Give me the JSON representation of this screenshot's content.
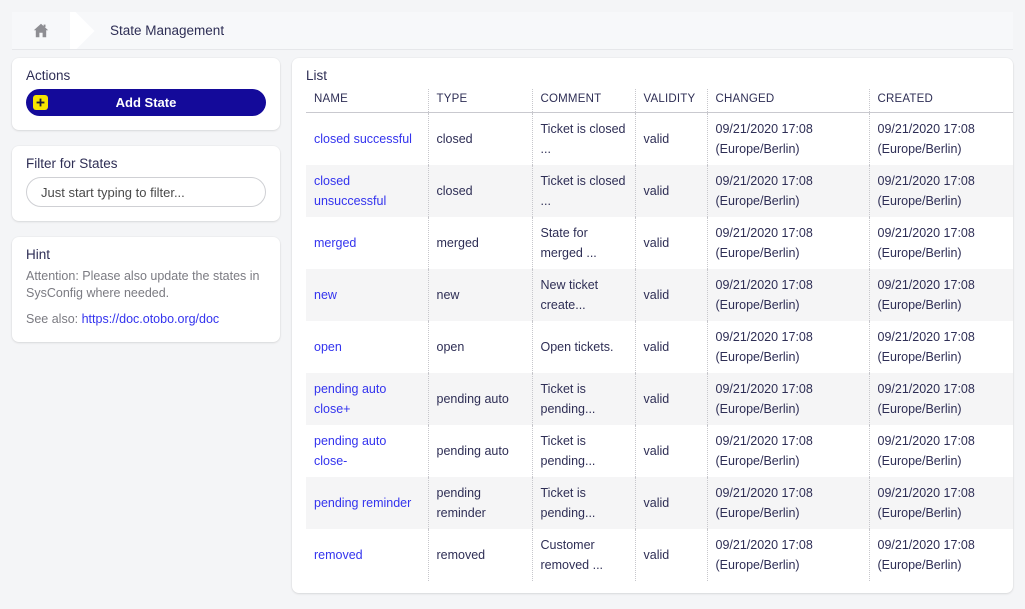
{
  "breadcrumb": {
    "home_icon": "home-icon",
    "separator_icon": "chevron-right-separator-icon",
    "title": "State Management"
  },
  "sidebar": {
    "actions": {
      "header": "Actions",
      "add_state_label": "Add State",
      "add_state_icon": "plus-icon"
    },
    "filter": {
      "header": "Filter for States",
      "placeholder": "Just start typing to filter...",
      "value": ""
    },
    "hint": {
      "header": "Hint",
      "text": "Attention: Please also update the states in SysConfig where needed.",
      "see_also_prefix": "See also: ",
      "link_text": "https://doc.otobo.org/doc"
    }
  },
  "main": {
    "list": {
      "header": "List",
      "columns": [
        "NAME",
        "TYPE",
        "COMMENT",
        "VALIDITY",
        "CHANGED",
        "CREATED"
      ],
      "rows": [
        {
          "name": "closed successful",
          "type": "closed",
          "comment": "Ticket is closed ...",
          "validity": "valid",
          "changed": "09/21/2020 17:08 (Europe/Berlin)",
          "created": "09/21/2020 17:08 (Europe/Berlin)"
        },
        {
          "name": "closed unsuccessful",
          "type": "closed",
          "comment": "Ticket is closed ...",
          "validity": "valid",
          "changed": "09/21/2020 17:08 (Europe/Berlin)",
          "created": "09/21/2020 17:08 (Europe/Berlin)"
        },
        {
          "name": "merged",
          "type": "merged",
          "comment": "State for merged ...",
          "validity": "valid",
          "changed": "09/21/2020 17:08 (Europe/Berlin)",
          "created": "09/21/2020 17:08 (Europe/Berlin)"
        },
        {
          "name": "new",
          "type": "new",
          "comment": "New ticket create...",
          "validity": "valid",
          "changed": "09/21/2020 17:08 (Europe/Berlin)",
          "created": "09/21/2020 17:08 (Europe/Berlin)"
        },
        {
          "name": "open",
          "type": "open",
          "comment": "Open tickets.",
          "validity": "valid",
          "changed": "09/21/2020 17:08 (Europe/Berlin)",
          "created": "09/21/2020 17:08 (Europe/Berlin)"
        },
        {
          "name": "pending auto close+",
          "type": "pending auto",
          "comment": "Ticket is pending...",
          "validity": "valid",
          "changed": "09/21/2020 17:08 (Europe/Berlin)",
          "created": "09/21/2020 17:08 (Europe/Berlin)"
        },
        {
          "name": "pending auto close-",
          "type": "pending auto",
          "comment": "Ticket is pending...",
          "validity": "valid",
          "changed": "09/21/2020 17:08 (Europe/Berlin)",
          "created": "09/21/2020 17:08 (Europe/Berlin)"
        },
        {
          "name": "pending reminder",
          "type": "pending reminder",
          "comment": "Ticket is pending...",
          "validity": "valid",
          "changed": "09/21/2020 17:08 (Europe/Berlin)",
          "created": "09/21/2020 17:08 (Europe/Berlin)"
        },
        {
          "name": "removed",
          "type": "removed",
          "comment": "Customer removed ...",
          "validity": "valid",
          "changed": "09/21/2020 17:08 (Europe/Berlin)",
          "created": "09/21/2020 17:08 (Europe/Berlin)"
        }
      ]
    }
  },
  "colors": {
    "page_background": "#f4f5f7",
    "primary_button": "#140a9a",
    "accent_yellow": "#f6e400",
    "link_blue": "#3333ee",
    "text_dark": "#2e2e55",
    "row_stripe": "#f5f5f6"
  }
}
